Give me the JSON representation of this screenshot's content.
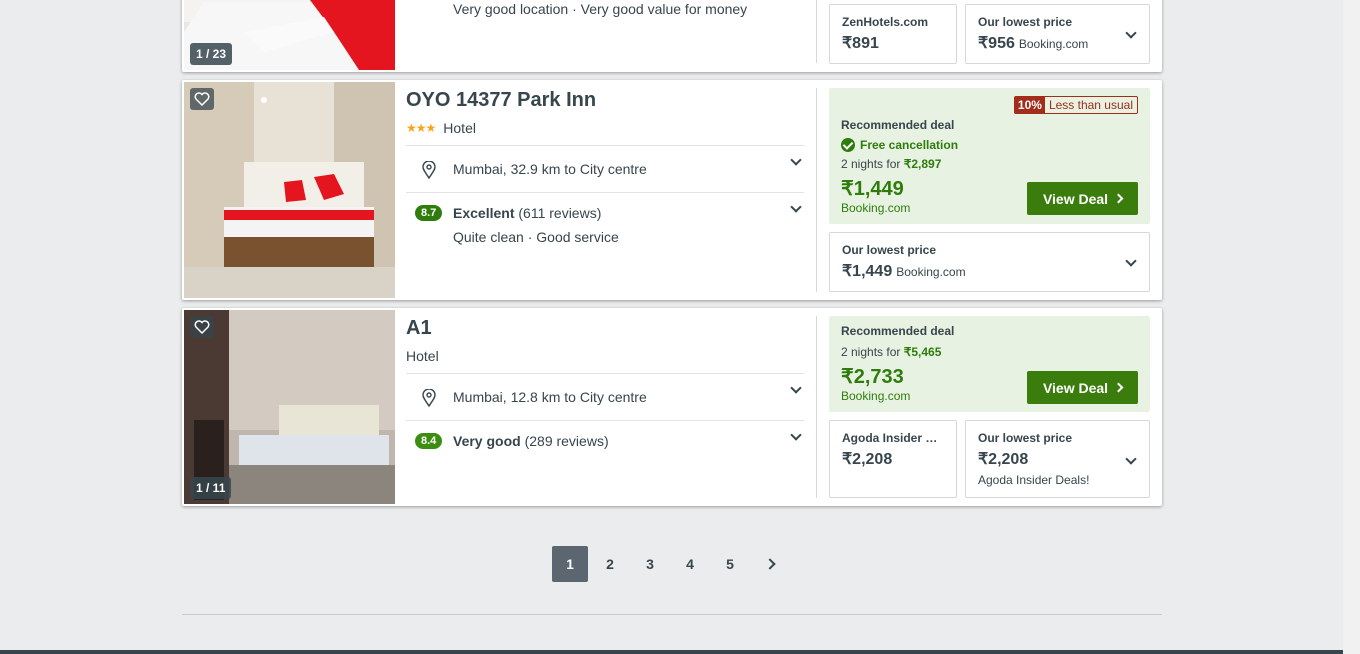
{
  "cards": [
    {
      "photo_counter": "1 / 23",
      "review_tags": "Very good location · Very good value for money",
      "left_box": {
        "title": "ZenHotels.com",
        "price": "₹891"
      },
      "right_box": {
        "title": "Our lowest price",
        "price": "₹956",
        "provider": "Booking.com"
      }
    },
    {
      "name": "OYO 14377 Park Inn",
      "stars": "★★★",
      "type": "Hotel",
      "location": "Mumbai, 32.9 km to City centre",
      "rating_score": "8.7",
      "rating_label": "Excellent",
      "rating_count": "(611 reviews)",
      "review_tags": "Quite clean · Good service",
      "deal": {
        "badge_pct": "10%",
        "badge_text": "Less than usual",
        "label": "Recommended deal",
        "free_cancel": "Free cancellation",
        "nights_prefix": "2 nights for ",
        "nights_price": "₹2,897",
        "price": "₹1,449",
        "provider": "Booking.com",
        "button": "View Deal"
      },
      "lowest": {
        "title": "Our lowest price",
        "price": "₹1,449",
        "provider": "Booking.com"
      }
    },
    {
      "name": "A1",
      "type": "Hotel",
      "photo_counter": "1 / 11",
      "location": "Mumbai, 12.8 km to City centre",
      "rating_score": "8.4",
      "rating_label": "Very good",
      "rating_count": "(289 reviews)",
      "deal": {
        "label": "Recommended deal",
        "nights_prefix": "2 nights for ",
        "nights_price": "₹5,465",
        "price": "₹2,733",
        "provider": "Booking.com",
        "button": "View Deal"
      },
      "left_box": {
        "title": "Agoda Insider Deals!",
        "price": "₹2,208"
      },
      "right_box": {
        "title": "Our lowest price",
        "price": "₹2,208",
        "provider": "Agoda Insider Deals!"
      }
    }
  ],
  "pagination": {
    "pages": [
      "1",
      "2",
      "3",
      "4",
      "5"
    ],
    "active": "1"
  },
  "colors": {
    "deal_green": "#2e7d0c",
    "deal_bg": "#e8f2e2",
    "badge_red": "#a12d1a",
    "star": "#f8a51a"
  }
}
